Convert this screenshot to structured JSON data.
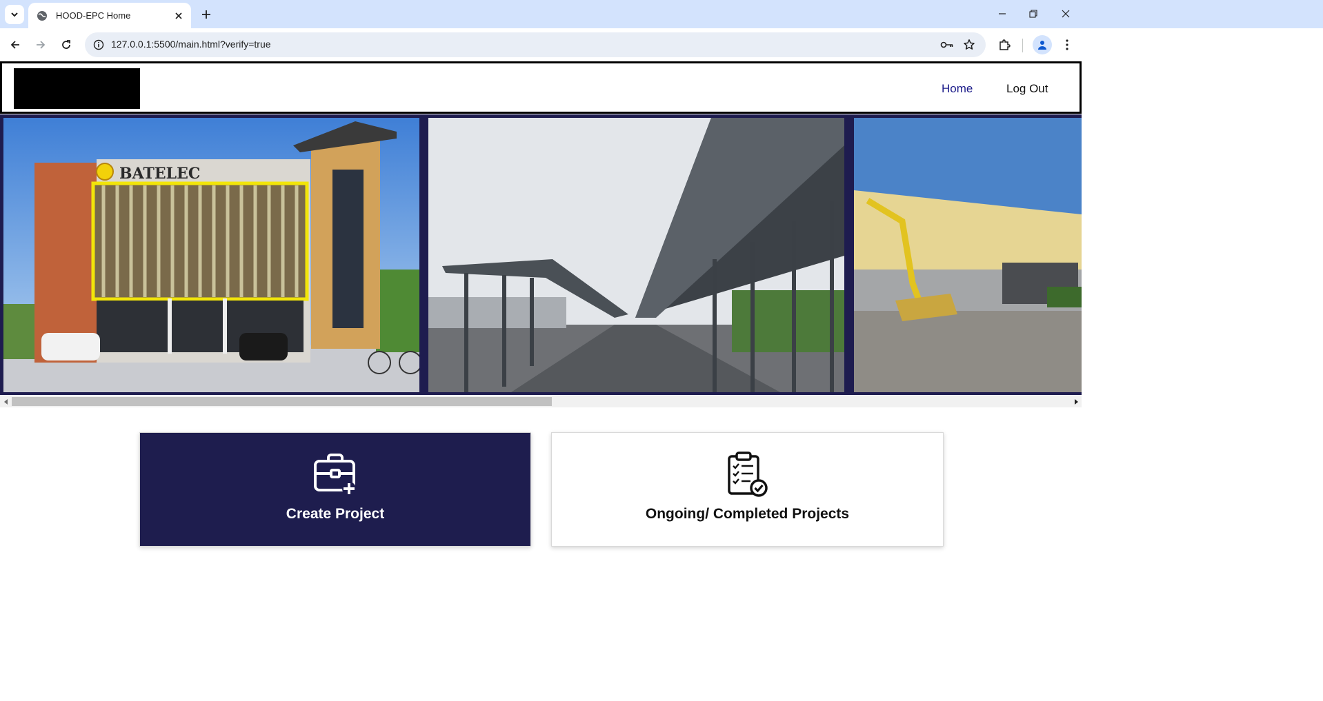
{
  "browser": {
    "tab_title": "HOOD-EPC Home",
    "url": "127.0.0.1:5500/main.html?verify=true"
  },
  "navbar": {
    "home_label": "Home",
    "logout_label": "Log Out"
  },
  "carousel": {
    "slides": [
      {
        "sign_text": "BATELEC"
      },
      {},
      {}
    ]
  },
  "actions": {
    "create_label": "Create Project",
    "ongoing_label": "Ongoing/ Completed Projects"
  },
  "colors": {
    "brand_navy": "#1e1d4e",
    "nav_active": "#1c1c8a",
    "tabstrip": "#d3e3fd"
  },
  "icons": {
    "create": "briefcase-plus-icon",
    "ongoing": "clipboard-check-icon"
  }
}
